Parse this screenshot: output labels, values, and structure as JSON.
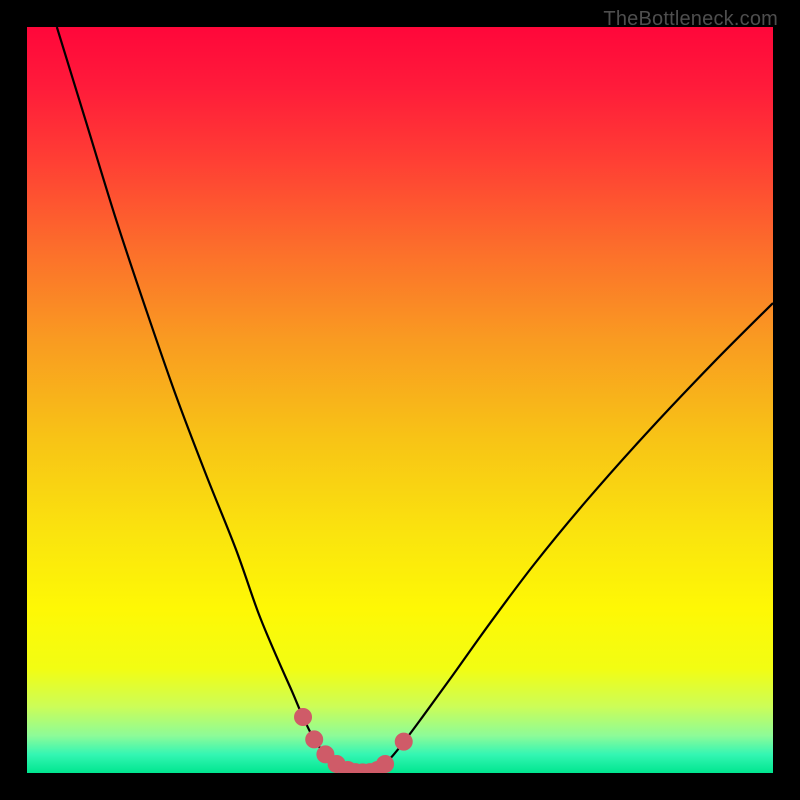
{
  "watermark": {
    "text": "TheBottleneck.com"
  },
  "colors": {
    "black": "#000000",
    "curve": "#000000",
    "marker_fill": "#cf5b68",
    "marker_stroke": "#cf5b68",
    "gradient_stops": [
      {
        "offset": 0.0,
        "color": "#ff073a"
      },
      {
        "offset": 0.08,
        "color": "#ff1b3a"
      },
      {
        "offset": 0.18,
        "color": "#ff3f34"
      },
      {
        "offset": 0.3,
        "color": "#fc6f2b"
      },
      {
        "offset": 0.42,
        "color": "#f99b21"
      },
      {
        "offset": 0.55,
        "color": "#f8c316"
      },
      {
        "offset": 0.68,
        "color": "#fae40e"
      },
      {
        "offset": 0.78,
        "color": "#fef805"
      },
      {
        "offset": 0.86,
        "color": "#f2fd13"
      },
      {
        "offset": 0.91,
        "color": "#cdfd56"
      },
      {
        "offset": 0.95,
        "color": "#8dfb98"
      },
      {
        "offset": 0.975,
        "color": "#34f6b3"
      },
      {
        "offset": 1.0,
        "color": "#00e68f"
      }
    ]
  },
  "chart_data": {
    "type": "line",
    "title": "",
    "xlabel": "",
    "ylabel": "",
    "xlim": [
      0,
      100
    ],
    "ylim": [
      0,
      100
    ],
    "grid": false,
    "series": [
      {
        "name": "bottleneck-curve",
        "x": [
          4,
          8,
          12,
          16,
          20,
          24,
          28,
          31,
          33.5,
          35.5,
          37,
          38.5,
          40,
          41.5,
          43,
          44,
          45,
          46,
          47,
          48,
          50,
          53,
          57,
          62,
          68,
          75,
          83,
          92,
          100
        ],
        "y": [
          100,
          87,
          74,
          62,
          50.5,
          40,
          30,
          21.5,
          15.5,
          11,
          7.5,
          4.5,
          2.5,
          1.2,
          0.4,
          0.12,
          0.08,
          0.12,
          0.4,
          1.2,
          3.5,
          7.5,
          13,
          20,
          28,
          36.5,
          45.5,
          55,
          63
        ]
      }
    ],
    "markers": {
      "name": "highlight-points",
      "x": [
        37,
        38.5,
        40,
        41.5,
        43,
        44,
        45,
        46,
        47,
        48,
        50.5
      ],
      "y": [
        7.5,
        4.5,
        2.5,
        1.2,
        0.4,
        0.12,
        0.08,
        0.12,
        0.4,
        1.2,
        4.2
      ]
    }
  }
}
